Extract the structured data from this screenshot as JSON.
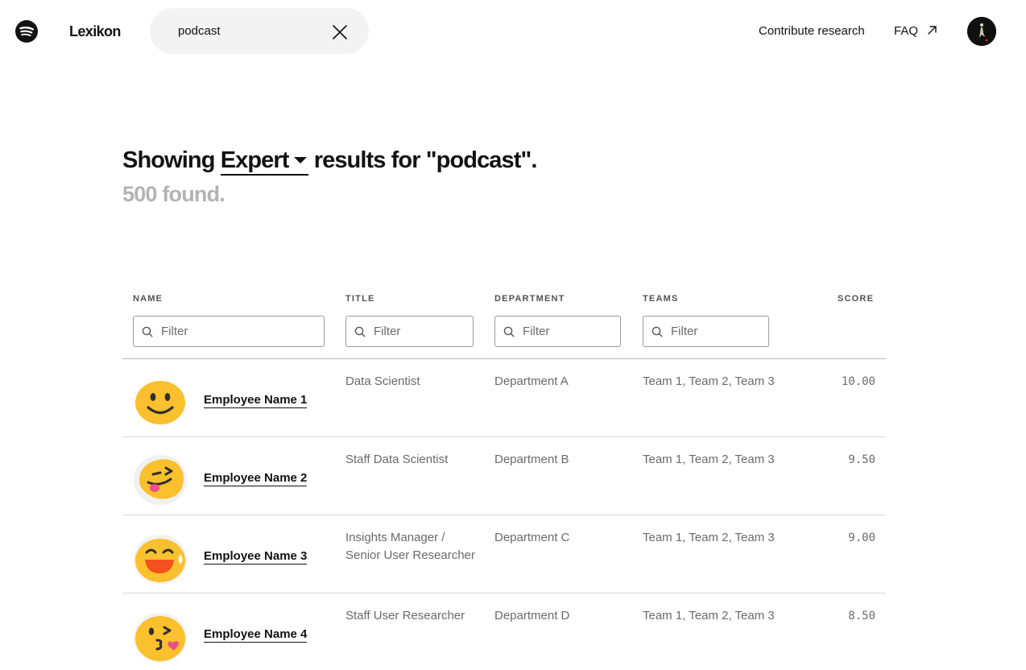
{
  "header": {
    "brand": "Lexikon",
    "search_value": "podcast",
    "nav": {
      "contribute": "Contribute research",
      "faq": "FAQ"
    },
    "icons": {
      "logo": "spotify-logo",
      "clear": "close-icon",
      "external": "arrow-up-right-icon",
      "avatar": "user-avatar"
    }
  },
  "results": {
    "prefix": "Showing",
    "type": "Expert",
    "suffix": "results for \"podcast\".",
    "count_text": "500 found."
  },
  "table": {
    "columns": [
      "NAME",
      "TITLE",
      "DEPARTMENT",
      "TEAMS",
      "SCORE"
    ],
    "filter_placeholder": "Filter",
    "rows": [
      {
        "emoji": "smiling-face-icon",
        "name": "Employee Name 1",
        "title": "Data Scientist",
        "department": "Department A",
        "teams": "Team 1, Team 2, Team 3",
        "score": "10.00"
      },
      {
        "emoji": "winking-tongue-face-icon",
        "name": "Employee Name 2",
        "title": "Staff Data Scientist",
        "department": "Department B",
        "teams": "Team 1, Team 2, Team 3",
        "score": "9.50"
      },
      {
        "emoji": "grinning-sweat-face-icon",
        "name": "Employee Name 3",
        "title": "Insights Manager / Senior User Researcher",
        "department": "Department C",
        "teams": "Team 1, Team 2, Team 3",
        "score": "9.00"
      },
      {
        "emoji": "kissing-face-icon",
        "name": "Employee Name 4",
        "title": "Staff User Researcher",
        "department": "Department D",
        "teams": "Team 1, Team 2, Team 3",
        "score": "8.50"
      }
    ]
  },
  "colors": {
    "text": "#121212",
    "muted": "#6a6a6a",
    "found": "#b3b3b3",
    "search_bg": "#f3f3f3",
    "emoji_yellow": "#fbc02d"
  }
}
